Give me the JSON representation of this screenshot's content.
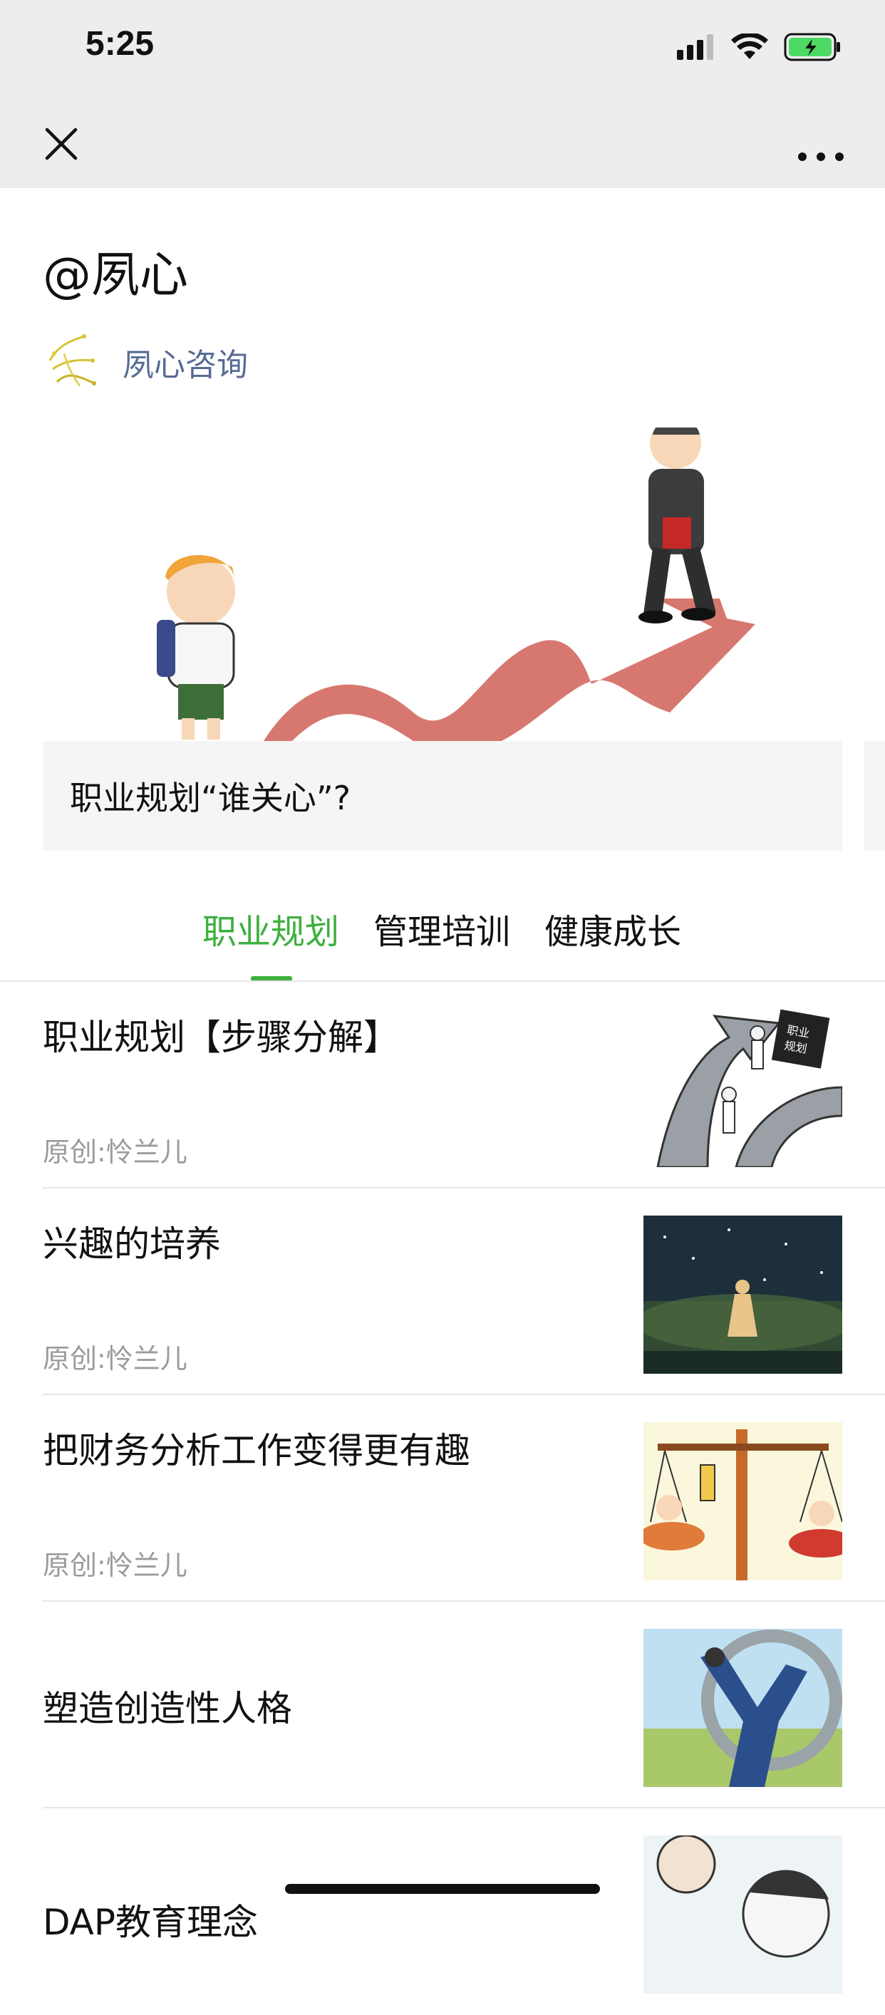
{
  "status_bar": {
    "time": "5:25",
    "icons": [
      "signal-icon",
      "wifi-icon",
      "battery-charging-icon"
    ]
  },
  "navbar": {
    "close_icon": "close-icon",
    "more_icon": "more-icon"
  },
  "page": {
    "title": "@夙心",
    "account": {
      "name": "夙心咨询",
      "logo_icon": "account-logo-icon"
    }
  },
  "featured": {
    "caption": "职业规划“谁关心”?"
  },
  "tabs": [
    {
      "label": "职业规划",
      "active": true
    },
    {
      "label": "管理培训",
      "active": false
    },
    {
      "label": "健康成长",
      "active": false
    }
  ],
  "articles": [
    {
      "title": "职业规划【步骤分解】",
      "meta": "原创:怜兰儿"
    },
    {
      "title": "兴趣的培养",
      "meta": "原创:怜兰儿"
    },
    {
      "title": "把财务分析工作变得更有趣",
      "meta": "原创:怜兰儿"
    },
    {
      "title": "塑造创造性人格",
      "meta": ""
    },
    {
      "title": "DAP教育理念",
      "meta": ""
    }
  ],
  "colors": {
    "accent": "#3eb03e",
    "link": "#576b95",
    "meta": "#9b9b9b",
    "topbar": "#ededed"
  }
}
